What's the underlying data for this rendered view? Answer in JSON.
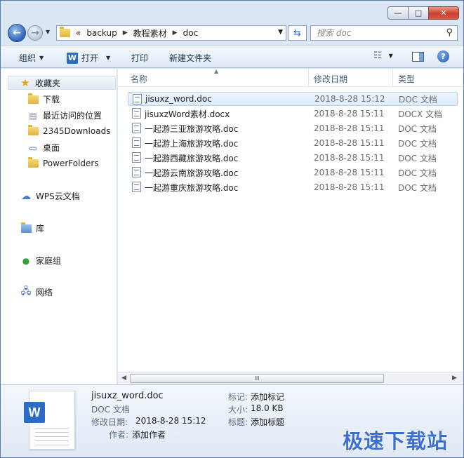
{
  "window": {
    "caption": {
      "minimize": "—",
      "maximize": "□",
      "close": "✕"
    }
  },
  "nav": {
    "back_glyph": "←",
    "forward_glyph": "→",
    "breadcrumb_prefix": "«",
    "breadcrumbs": [
      "backup",
      "教程素材",
      "doc"
    ],
    "refresh_glyph": "⇆",
    "search_placeholder": "搜索 doc"
  },
  "toolbar": {
    "organize": "组织",
    "open": "打开",
    "print": "打印",
    "new_folder": "新建文件夹"
  },
  "sidebar": {
    "favorites": "收藏夹",
    "favorites_items": [
      "下载",
      "最近访问的位置",
      "2345Downloads",
      "桌面",
      "PowerFolders"
    ],
    "wps_cloud": "WPS云文档",
    "library": "库",
    "homegroup": "家庭组",
    "network": "网络"
  },
  "columns": {
    "name": "名称",
    "date": "修改日期",
    "type": "类型"
  },
  "files": [
    {
      "name": "jisuxz_word.doc",
      "date": "2018-8-28 15:12",
      "type": "DOC 文档"
    },
    {
      "name": "jisuxzWord素材.docx",
      "date": "2018-8-28 15:11",
      "type": "DOCX 文档"
    },
    {
      "name": "一起游三亚旅游攻略.doc",
      "date": "2018-8-28 15:11",
      "type": "DOC 文档"
    },
    {
      "name": "一起游上海旅游攻略.doc",
      "date": "2018-8-28 15:11",
      "type": "DOC 文档"
    },
    {
      "name": "一起游西藏旅游攻略.doc",
      "date": "2018-8-28 15:11",
      "type": "DOC 文档"
    },
    {
      "name": "一起游云南旅游攻略.doc",
      "date": "2018-8-28 15:11",
      "type": "DOC 文档"
    },
    {
      "name": "一起游重庆旅游攻略.doc",
      "date": "2018-8-28 15:11",
      "type": "DOC 文档"
    }
  ],
  "scrollbar": {
    "grip": "III"
  },
  "details": {
    "filename": "jisuxz_word.doc",
    "filetype": "DOC 文档",
    "modified_label": "修改日期:",
    "modified_value": "2018-8-28 15:12",
    "author_label": "作者:",
    "author_value": "添加作者",
    "tags_label": "标记:",
    "tags_value": "添加标记",
    "size_label": "大小:",
    "size_value": "18.0 KB",
    "title_label": "标题:",
    "title_value": "添加标题"
  },
  "watermark": "极速下载站",
  "colors": {
    "accent": "#2b6cc4",
    "selection": "#dcebfc",
    "watermark": "#3b6fd4"
  }
}
